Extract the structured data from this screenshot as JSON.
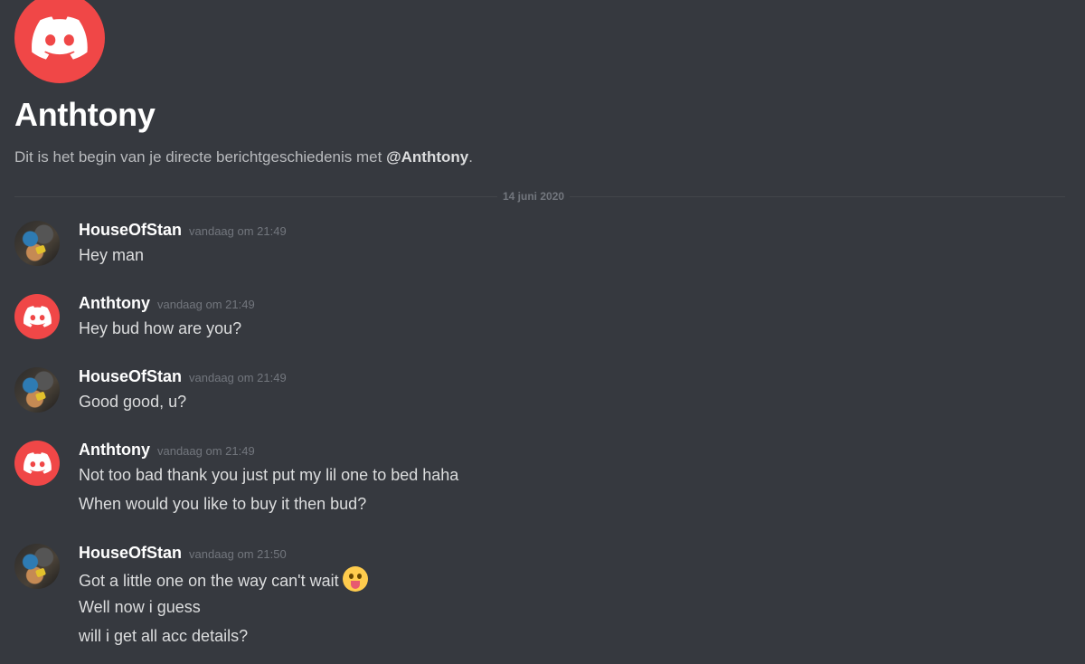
{
  "intro": {
    "avatar_icon": "discord-logo-icon",
    "title": "Anthtony",
    "desc_prefix": "Dit is het begin van je directe berichtgeschiedenis met ",
    "mention": "@Anthtony",
    "desc_suffix": "."
  },
  "divider": {
    "date": "14 juni 2020"
  },
  "colors": {
    "background": "#36393f",
    "avatar_red": "#f04747",
    "username": "#ffffff",
    "timestamp": "#72767d"
  },
  "messages": [
    {
      "user": "HouseOfStan",
      "time": "vandaag om 21:49",
      "lines": [
        "Hey man"
      ]
    },
    {
      "user": "Anthtony",
      "time": "vandaag om 21:49",
      "lines": [
        "Hey bud how are you?"
      ]
    },
    {
      "user": "HouseOfStan",
      "time": "vandaag om 21:49",
      "lines": [
        "Good good, u?"
      ]
    },
    {
      "user": "Anthtony",
      "time": "vandaag om 21:49",
      "lines": [
        "Not too bad thank you just put my lil one to bed haha",
        "When would you like to buy it then bud?"
      ]
    },
    {
      "user": "HouseOfStan",
      "time": "vandaag om 21:50",
      "lines": [
        "Got a little one on the way can't wait",
        "Well now i guess",
        "will i get all acc details?"
      ],
      "emoji": "tongue-out-face-emoji"
    }
  ]
}
